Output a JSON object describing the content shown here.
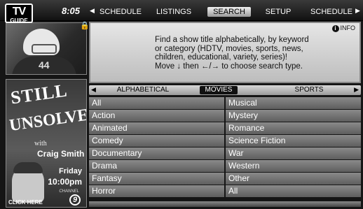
{
  "header": {
    "logo_top": "TV",
    "logo_bottom": "GUIDE",
    "clock": "8:05",
    "tabs": [
      {
        "label": "SCHEDULE",
        "selected": false
      },
      {
        "label": "LISTINGS",
        "selected": false
      },
      {
        "label": "SEARCH",
        "selected": true
      },
      {
        "label": "SETUP",
        "selected": false
      },
      {
        "label": "SCHEDULE",
        "selected": false
      }
    ]
  },
  "preview": {
    "jersey_number": "44"
  },
  "ad": {
    "title_line1": "STILL",
    "title_line2": "UNSOLVED",
    "with": "with",
    "host": "Craig Smith",
    "day": "Friday",
    "time": "10:00pm",
    "channel_label": "CHANNEL",
    "channel_number": "9",
    "click_here": "CLICK HERE"
  },
  "info": {
    "button_label": "INFO",
    "lines": [
      "Find a show title alphabetically, by keyword",
      "or category (HDTV, movies, sports, news,",
      "children, educational, variety, series)!",
      "Move ↓ then ←/→ to choose search type."
    ]
  },
  "categories": {
    "items": [
      {
        "label": "ALPHABETICAL",
        "selected": false
      },
      {
        "label": "MOVIES",
        "selected": true
      },
      {
        "label": "SPORTS",
        "selected": false
      }
    ]
  },
  "genres": {
    "left": [
      "All",
      "Action",
      "Animated",
      "Comedy",
      "Documentary",
      "Drama",
      "Fantasy",
      "Horror"
    ],
    "right": [
      "Musical",
      "Mystery",
      "Romance",
      "Science Fiction",
      "War",
      "Western",
      "Other",
      "All"
    ]
  },
  "colors": {
    "selected_tab_bg": "#d8d8d8",
    "selected_category_bg": "#111111",
    "cell_bg": "#747474"
  }
}
